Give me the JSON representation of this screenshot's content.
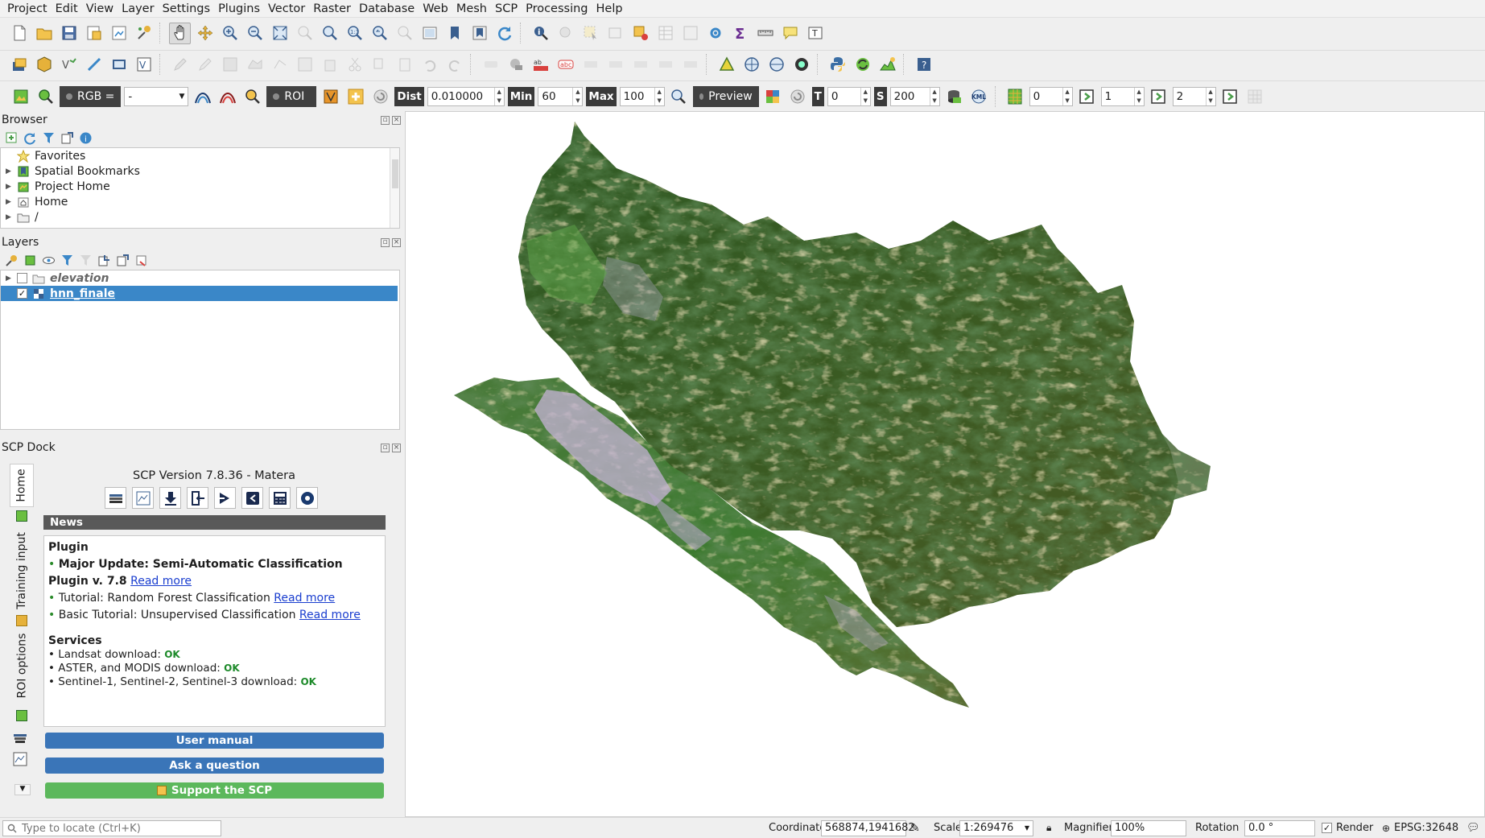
{
  "menu": [
    "Project",
    "Edit",
    "View",
    "Layer",
    "Settings",
    "Plugins",
    "Vector",
    "Raster",
    "Database",
    "Web",
    "Mesh",
    "SCP",
    "Processing",
    "Help"
  ],
  "scp_toolbar": {
    "rgb_label": "RGB =",
    "rgb_value": "-",
    "roi_label": "ROI",
    "dist_label": "Dist",
    "dist_value": "0.010000",
    "min_label": "Min",
    "min_value": "60",
    "max_label": "Max",
    "max_value": "100",
    "preview_label": "Preview",
    "t_label": "T",
    "t_value": "0",
    "s_label": "S",
    "s_value": "200",
    "kml_label": "KML",
    "band_values": [
      "0",
      "1",
      "2"
    ]
  },
  "browser": {
    "title": "Browser",
    "items": [
      {
        "label": "Favorites",
        "icon": "star-icon"
      },
      {
        "label": "Spatial Bookmarks",
        "icon": "bookmark-icon"
      },
      {
        "label": "Project Home",
        "icon": "project-home-icon"
      },
      {
        "label": "Home",
        "icon": "home-folder-icon"
      },
      {
        "label": "/",
        "icon": "folder-icon"
      }
    ]
  },
  "layers": {
    "title": "Layers",
    "items": [
      {
        "label": "elevation",
        "checked": false,
        "icon": "group-icon"
      },
      {
        "label": "hnn_finale",
        "checked": true,
        "icon": "raster-icon"
      }
    ]
  },
  "scp_dock": {
    "title": "SCP Dock",
    "version": "SCP Version 7.8.36 - Matera",
    "tabs": [
      "Home",
      "Training input",
      "ROI options"
    ],
    "news_header": "News",
    "plugin_heading": "Plugin",
    "news_items": [
      {
        "text": "Major Update: Semi-Automatic Classification Plugin v. 7.8",
        "link": "Read more",
        "bold": true
      },
      {
        "text": "Tutorial: Random Forest Classification",
        "link": "Read more",
        "bold": false
      },
      {
        "text": "Basic Tutorial: Unsupervised Classification",
        "link": "Read more",
        "bold": false
      }
    ],
    "services_heading": "Services",
    "services": [
      {
        "text": "• Landsat download:",
        "status": "OK"
      },
      {
        "text": "• ASTER, and MODIS download:",
        "status": "OK"
      },
      {
        "text": "• Sentinel-1, Sentinel-2, Sentinel-3 download:",
        "status": "OK"
      }
    ],
    "buttons": {
      "manual": "User manual",
      "ask": "Ask a question",
      "support": "Support the SCP"
    }
  },
  "status": {
    "locate_placeholder": "Type to locate (Ctrl+K)",
    "coordinate_label": "Coordinate",
    "coordinate_value": "568874,1941682",
    "scale_label": "Scale",
    "scale_value": "1:269476",
    "magnifier_label": "Magnifier",
    "magnifier_value": "100%",
    "rotation_label": "Rotation",
    "rotation_value": "0.0 °",
    "render_label": "Render",
    "crs_label": "EPSG:32648"
  },
  "colors": {
    "selection": "#3a87c8",
    "news_bar": "#595959",
    "blue_button": "#3a75b8",
    "green_button": "#5cb85c",
    "ok_green": "#1d8a2a"
  }
}
